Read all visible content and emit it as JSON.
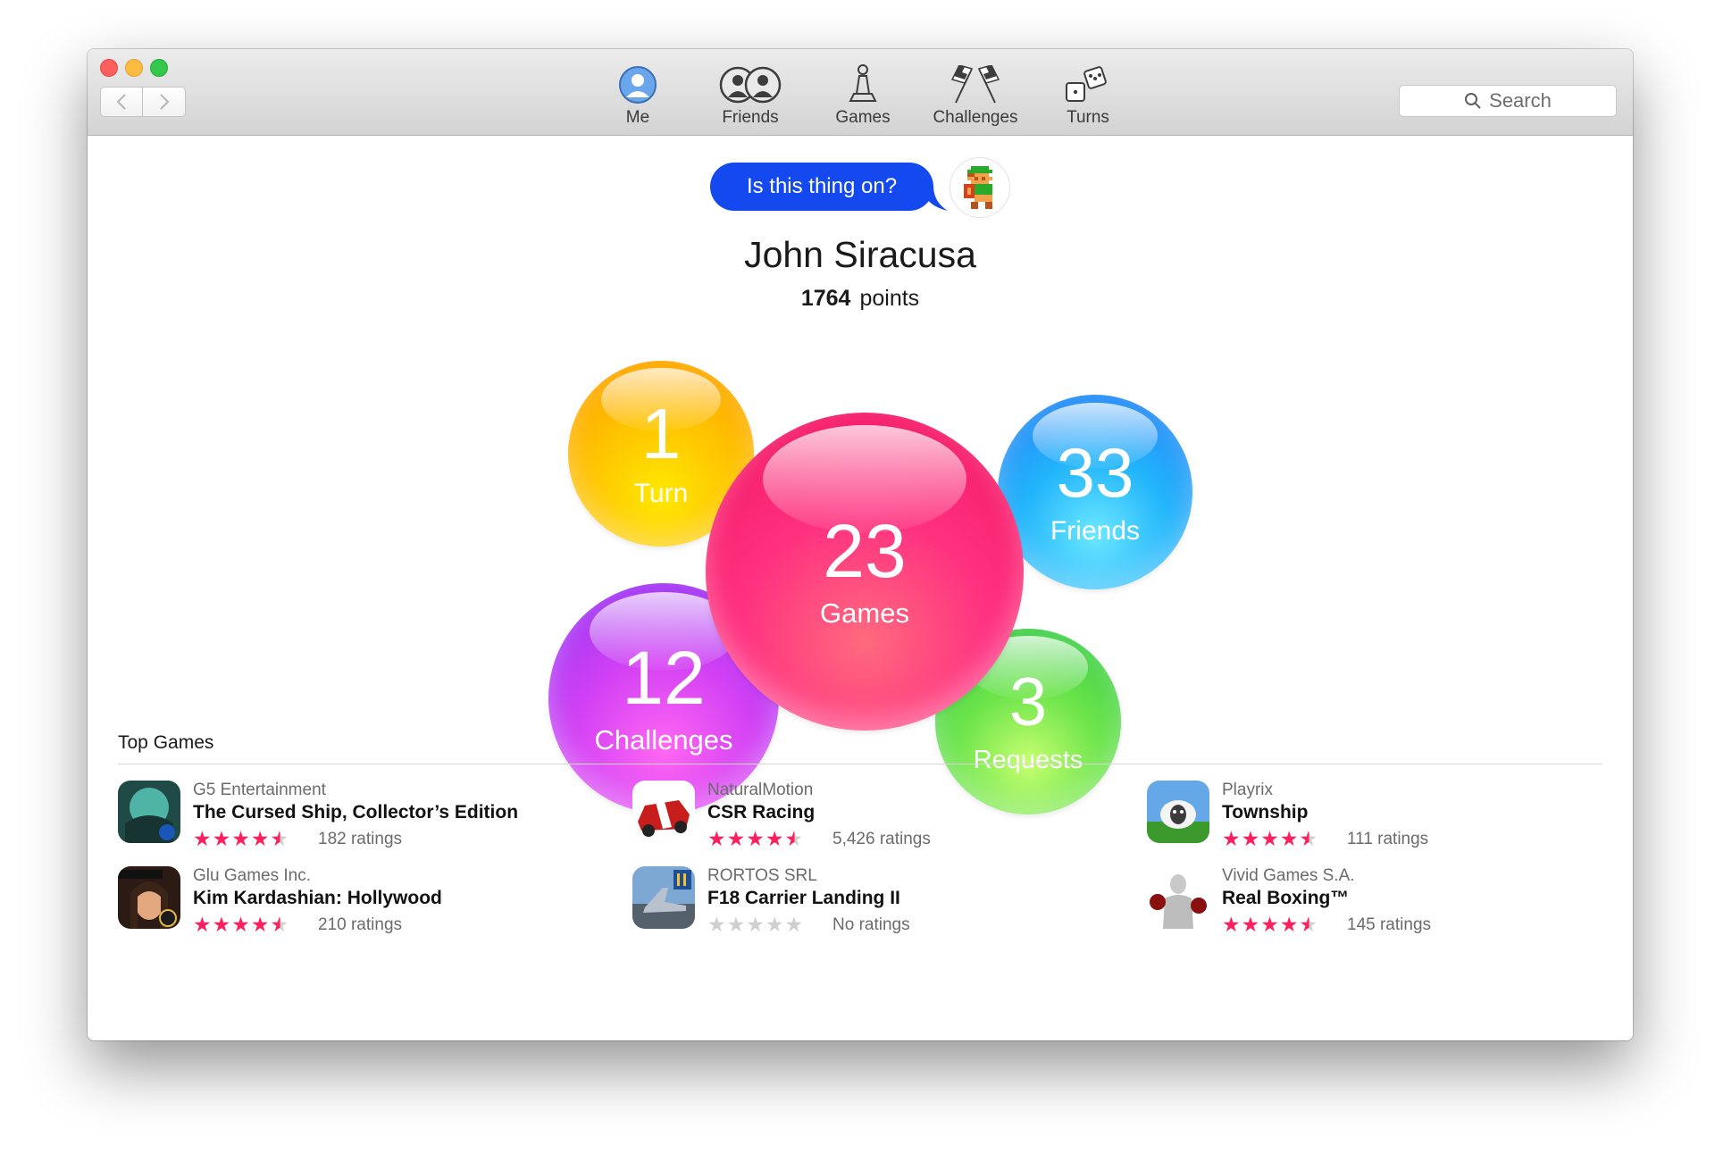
{
  "toolbar": {
    "tabs": [
      {
        "label": "Me",
        "icon": "me-avatar-icon"
      },
      {
        "label": "Friends",
        "icon": "friends-icon"
      },
      {
        "label": "Games",
        "icon": "pawn-icon"
      },
      {
        "label": "Challenges",
        "icon": "checkered-flags-icon"
      },
      {
        "label": "Turns",
        "icon": "dice-icon"
      }
    ],
    "search_placeholder": "Search"
  },
  "profile": {
    "status": "Is this thing on?",
    "name": "John Siracusa",
    "points_value": "1764",
    "points_label": "points"
  },
  "bubbles": {
    "turn": {
      "number": "1",
      "label": "Turn",
      "color": "#ffc400"
    },
    "friends": {
      "number": "33",
      "label": "Friends",
      "color": "#21b4fb"
    },
    "challenges": {
      "number": "12",
      "label": "Challenges",
      "color": "#c23ff4"
    },
    "requests": {
      "number": "3",
      "label": "Requests",
      "color": "#5fdc4a"
    },
    "games": {
      "number": "23",
      "label": "Games",
      "color": "#ff3180"
    }
  },
  "top_games": {
    "title": "Top Games",
    "games": [
      {
        "developer": "G5 Entertainment",
        "title": "The Cursed Ship, Collector’s Edition",
        "rating": 4.5,
        "ratings_text": "182 ratings"
      },
      {
        "developer": "NaturalMotion",
        "title": "CSR Racing",
        "rating": 4.5,
        "ratings_text": "5,426 ratings"
      },
      {
        "developer": "Playrix",
        "title": "Township",
        "rating": 4.5,
        "ratings_text": "111 ratings"
      },
      {
        "developer": "Glu Games Inc.",
        "title": "Kim Kardashian: Hollywood",
        "rating": 4.5,
        "ratings_text": "210 ratings"
      },
      {
        "developer": "RORTOS SRL",
        "title": "F18 Carrier Landing II",
        "rating": 0,
        "ratings_text": "No ratings"
      },
      {
        "developer": "Vivid Games S.A.",
        "title": "Real Boxing™",
        "rating": 4.5,
        "ratings_text": "145 ratings"
      }
    ]
  },
  "colors": {
    "accent_star": "#ff1f5e",
    "speech_bubble": "#1549f0"
  }
}
